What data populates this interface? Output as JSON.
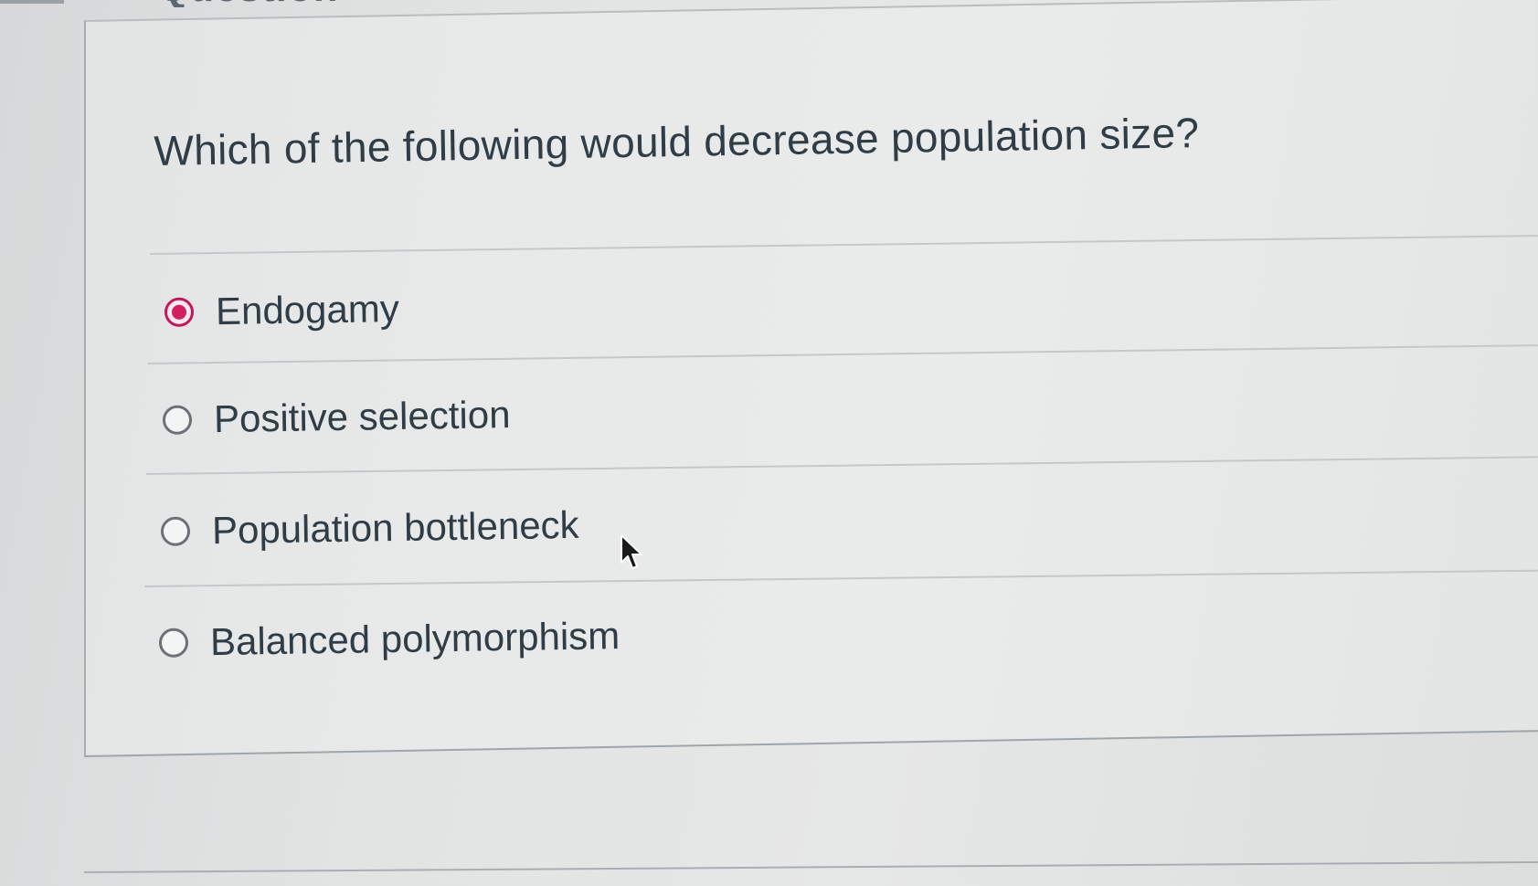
{
  "question": {
    "heading_fragment": "Question",
    "text": "Which of the following would decrease population size?"
  },
  "answers": [
    {
      "label": "Endogamy",
      "selected": true
    },
    {
      "label": "Positive selection",
      "selected": false
    },
    {
      "label": "Population bottleneck",
      "selected": false
    },
    {
      "label": "Balanced polymorphism",
      "selected": false
    }
  ],
  "colors": {
    "selected_accent": "#d21f5d",
    "text": "#2f3d47",
    "radio_border": "#6b7177"
  },
  "icons": {
    "pointer": "mouse-pointer-icon"
  }
}
